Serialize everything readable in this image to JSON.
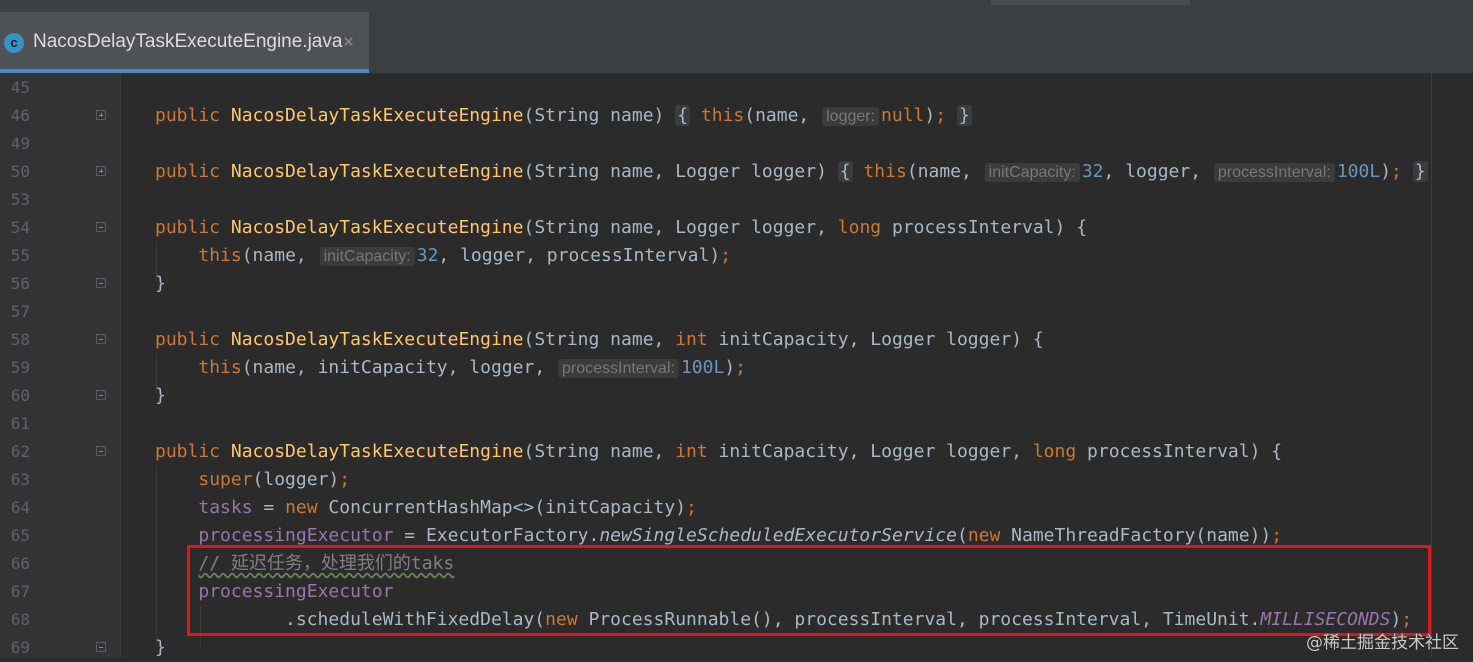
{
  "tab": {
    "icon_letter": "c",
    "filename": "NacosDelayTaskExecuteEngine.java",
    "close": "×"
  },
  "line_numbers": [
    "45",
    "46",
    "49",
    "50",
    "53",
    "54",
    "55",
    "56",
    "57",
    "58",
    "59",
    "60",
    "61",
    "62",
    "63",
    "64",
    "65",
    "66",
    "67",
    "68",
    "69"
  ],
  "hints": {
    "logger": "logger:",
    "initCapacity": "initCapacity:",
    "processInterval": "processInterval:"
  },
  "comment_text": "// 延迟任务，处理我们的taks",
  "watermark": "@稀土掘金技术社区",
  "colors": {
    "background": "#2b2b2b",
    "gutter": "#313335",
    "keyword": "#cc7832",
    "method": "#ffc66d",
    "field": "#9876aa",
    "number": "#6897bb",
    "highlight_box": "#e0141c"
  }
}
